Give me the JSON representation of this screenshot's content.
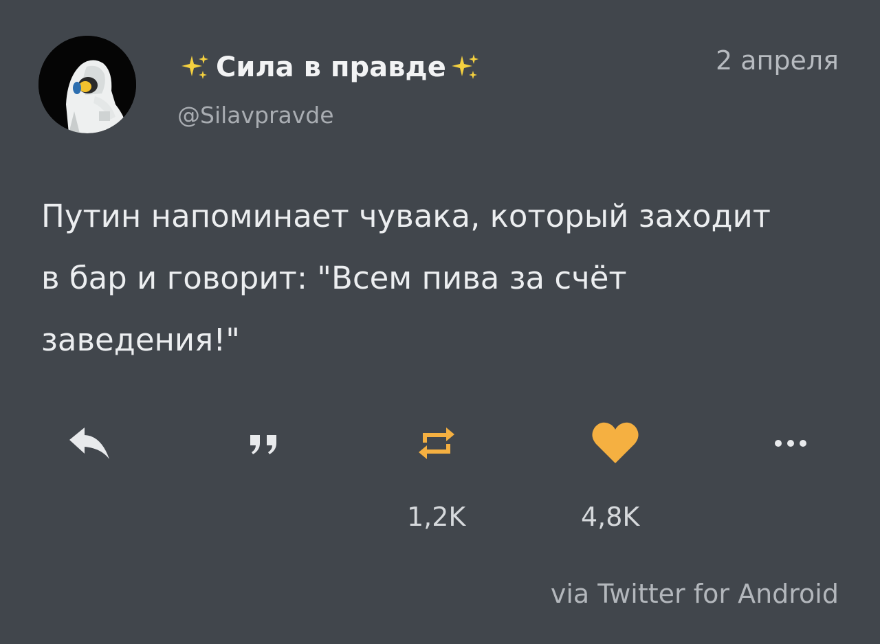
{
  "account": {
    "display_name": "Сила в правде",
    "handle": "@Silavpravde",
    "avatar_icon": "hazmat-suit-person-avatar"
  },
  "date": "2 апреля",
  "tweet": {
    "lines": [
      "Путин напоминает чувака, который заходит",
      "в бар и говорит: \"Всем пива за счёт",
      "заведения!\""
    ]
  },
  "actions": {
    "reply_icon": "reply-arrow-icon",
    "quote_icon": "quote-icon",
    "retweet_icon": "retweet-icon",
    "like_icon": "heart-icon",
    "more_icon": "more-dots-icon",
    "retweet_count": "1,2K",
    "like_count": "4,8K"
  },
  "source": "via Twitter for Android",
  "colors": {
    "background": "#41464c",
    "accent": "#f5b041",
    "sparkle": "#f4d03f"
  }
}
